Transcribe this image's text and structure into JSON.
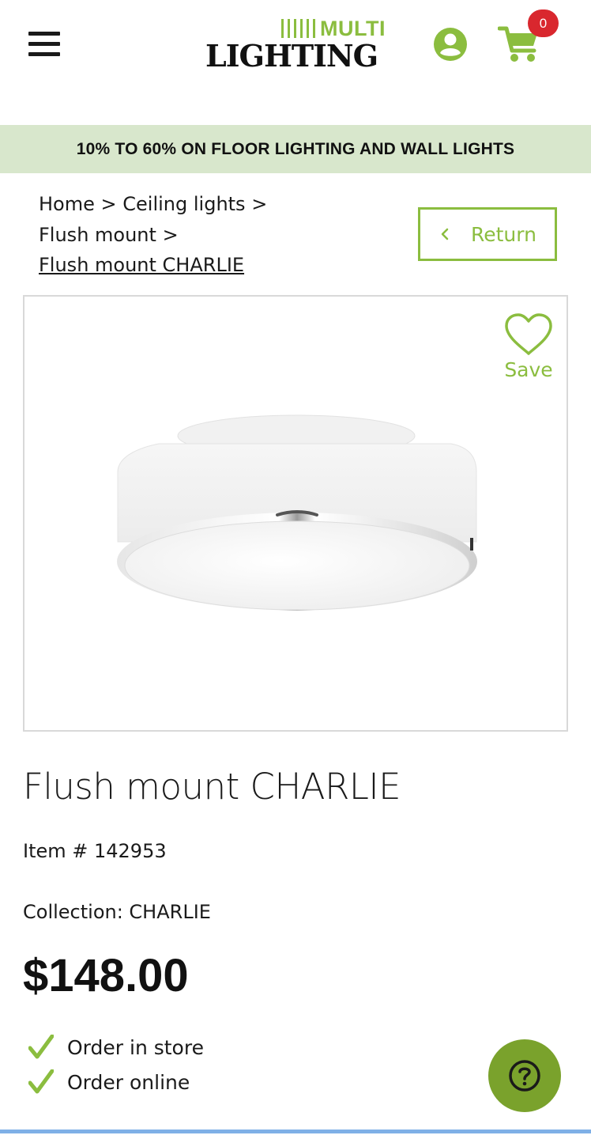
{
  "header": {
    "logo_top": "MULTI",
    "logo_bottom": "LIGHTING",
    "cart_count": "0",
    "icons": {
      "menu": "hamburger-menu-icon",
      "account": "user-circle-icon",
      "cart": "shopping-cart-icon"
    }
  },
  "promo": {
    "text": "10% TO 60% ON FLOOR LIGHTING AND WALL LIGHTS"
  },
  "breadcrumb": {
    "items": [
      "Home",
      "Ceiling lights",
      "Flush mount"
    ],
    "separator": ">",
    "current": "Flush mount CHARLIE"
  },
  "return_button": {
    "label": "Return",
    "icon": "chevron-left-icon"
  },
  "save_button": {
    "label": "Save",
    "icon": "heart-outline-icon"
  },
  "product": {
    "title": "Flush mount CHARLIE",
    "item_number": "Item # 142953",
    "collection": "Collection: CHARLIE",
    "price": "$148.00",
    "availability": [
      "Order in store",
      "Order online"
    ]
  },
  "help_button": {
    "icon": "question-circle-icon"
  },
  "colors": {
    "accent_green": "#8bbd3f",
    "promo_bg": "#d8e7cc",
    "badge_red": "#d9272e",
    "help_bg": "#7aa22c",
    "bottom_line": "#7fb0e6"
  }
}
